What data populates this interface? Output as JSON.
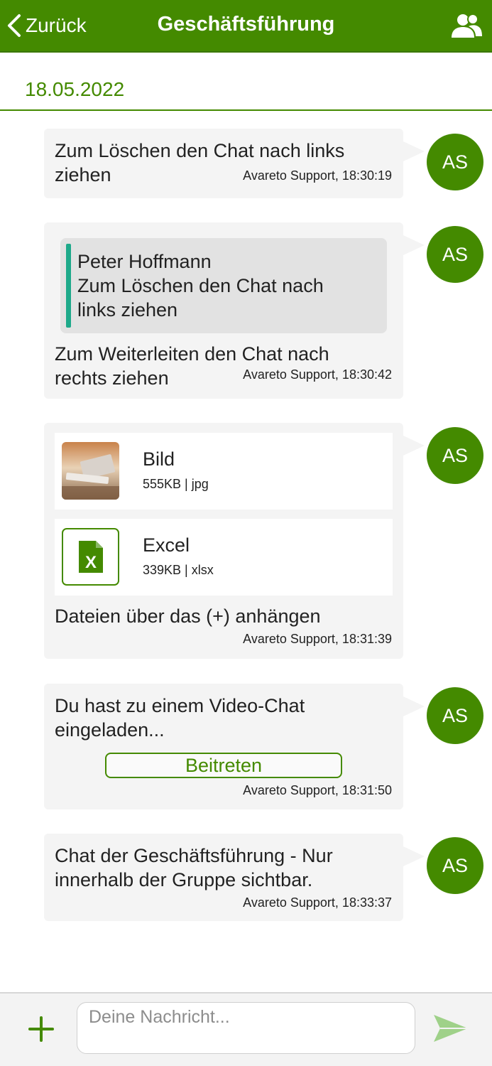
{
  "header": {
    "back_label": "Zurück",
    "title": "Geschäftsführung",
    "group_icon": "group-icon"
  },
  "date": "18.05.2022",
  "messages": [
    {
      "text": "Zum Löschen den Chat nach links ziehen",
      "meta": "Avareto Support, 18:30:19",
      "avatar": "AS"
    },
    {
      "quote_author": "Peter Hoffmann",
      "quote_text": "Zum Löschen den Chat nach links ziehen",
      "text": "Zum Weiterleiten den Chat nach rechts ziehen",
      "meta": "Avareto Support, 18:30:42",
      "avatar": "AS"
    },
    {
      "attachments": [
        {
          "name": "Bild",
          "info": "555KB | jpg",
          "icon": "image-thumbnail"
        },
        {
          "name": "Excel",
          "info": "339KB | xlsx",
          "icon": "excel-file-icon"
        }
      ],
      "text": "Dateien über das (+) anhängen",
      "meta": "Avareto Support, 18:31:39",
      "avatar": "AS"
    },
    {
      "text": "Du hast zu einem Video-Chat eingeladen...",
      "button_label": "Beitreten",
      "meta": "Avareto Support, 18:31:50",
      "avatar": "AS"
    },
    {
      "text": "Chat der Geschäftsführung - Nur innerhalb der Gruppe sichtbar.",
      "meta": "Avareto Support, 18:33:37",
      "avatar": "AS"
    }
  ],
  "composer": {
    "placeholder": "Deine Nachricht...",
    "add_icon": "plus-icon",
    "send_icon": "send-icon"
  },
  "colors": {
    "brand_green": "#448a00",
    "bubble": "#f4f4f4",
    "quote_bar": "#1ea98a"
  }
}
